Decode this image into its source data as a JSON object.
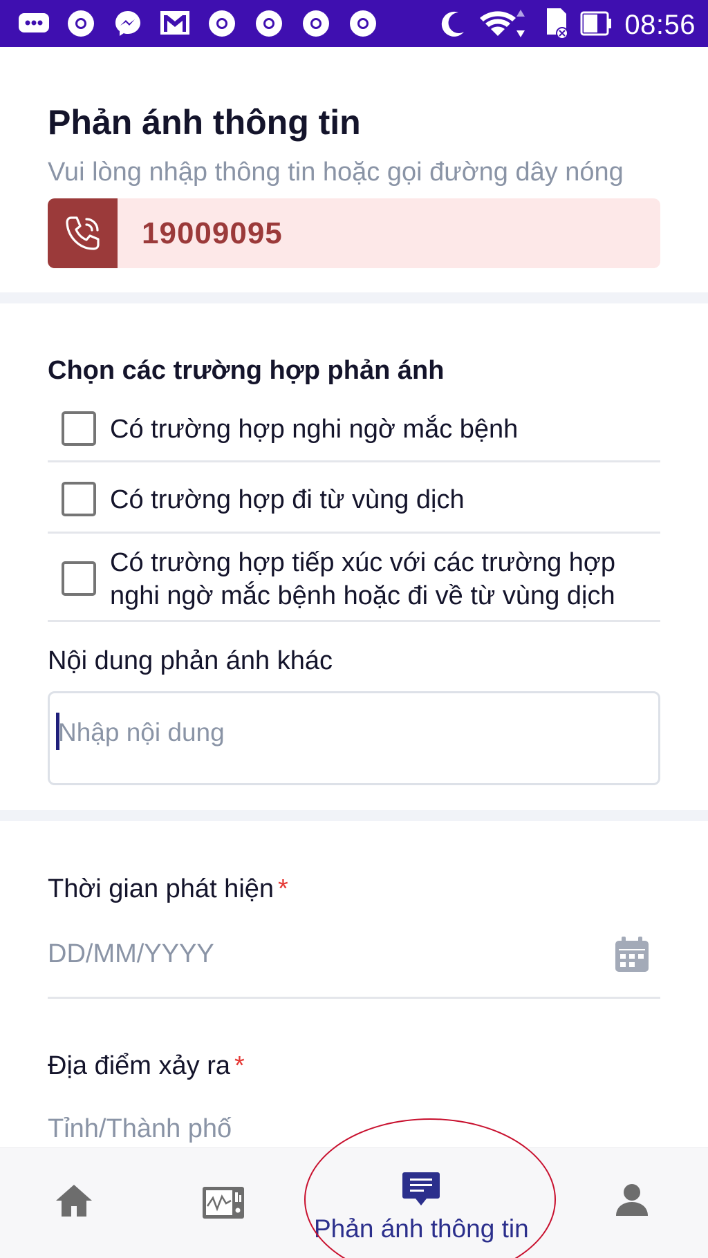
{
  "status_bar": {
    "time": "08:56",
    "left_icons": [
      "messages-icon",
      "chrome-icon",
      "messenger-icon",
      "gmail-icon",
      "chrome-icon",
      "chrome-icon",
      "chrome-icon",
      "chrome-icon"
    ],
    "right_icons": [
      "moon-icon",
      "wifi-icon",
      "sd-card-icon",
      "battery-icon"
    ],
    "background": "#3f0fb0"
  },
  "header": {
    "title": "Phản ánh thông tin",
    "subtitle": "Vui lòng nhập thông tin hoặc gọi đường dây nóng",
    "hotline": "19009095",
    "hotline_color": "#9b3a3a"
  },
  "cases": {
    "label": "Chọn các trường hợp phản ánh",
    "options": [
      {
        "text": "Có trường hợp nghi ngờ mắc bệnh",
        "checked": false
      },
      {
        "text": "Có trường hợp đi từ vùng dịch",
        "checked": false
      },
      {
        "text": "Có trường hợp tiếp xúc với các trường hợp nghi ngờ mắc bệnh hoặc đi về từ vùng dịch",
        "checked": false
      }
    ]
  },
  "other_content": {
    "label": "Nội dung phản ánh khác",
    "placeholder": "Nhập nội dung",
    "value": ""
  },
  "detection_time": {
    "label": "Thời gian phát hiện",
    "required_mark": "*",
    "placeholder": "DD/MM/YYYY"
  },
  "location": {
    "label": "Địa điểm xảy ra",
    "required_mark": "*",
    "province_placeholder": "Tỉnh/Thành phố"
  },
  "bottom_nav": {
    "items": [
      {
        "icon": "home-icon"
      },
      {
        "icon": "monitor-chart-icon"
      },
      {
        "icon": "chat-report-icon",
        "label": "Phản ánh thông tin",
        "active": true
      },
      {
        "icon": "user-icon"
      }
    ],
    "active_color": "#2b2f8c"
  }
}
